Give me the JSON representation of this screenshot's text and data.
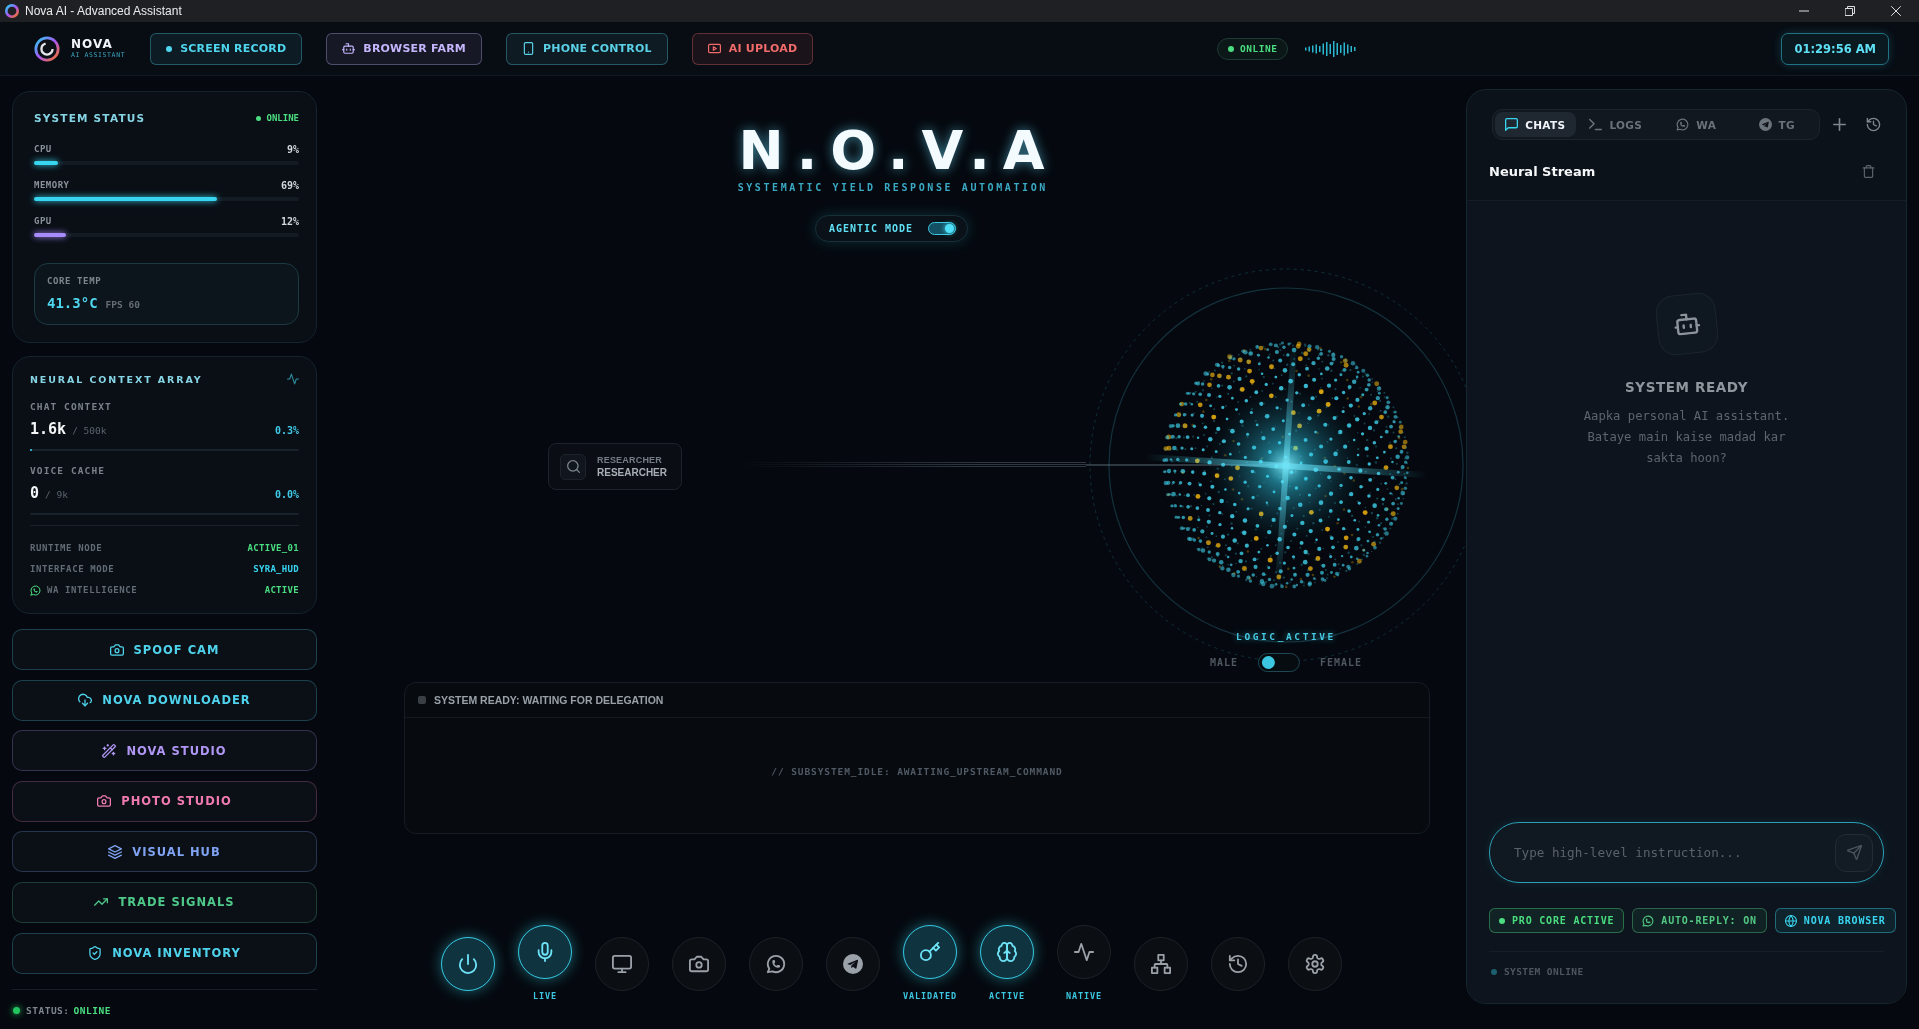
{
  "window": {
    "title": "Nova AI - Advanced Assistant"
  },
  "header": {
    "brand": "NOVA",
    "tagline": "AI ASSISTANT",
    "buttons": [
      {
        "label": "SCREEN RECORD",
        "kind": "record",
        "color": "#4fd6ef"
      },
      {
        "label": "BROWSER FARM",
        "kind": "bot",
        "color": "#c4b5fd"
      },
      {
        "label": "PHONE CONTROL",
        "kind": "phone",
        "color": "#5ad1e6"
      },
      {
        "label": "AI UPLOAD",
        "kind": "video",
        "color": "#f26b6b"
      }
    ],
    "status": "ONLINE",
    "clock": "01:29:56 AM"
  },
  "system_status": {
    "title": "SYSTEM STATUS",
    "status": "ONLINE",
    "meters": [
      {
        "name": "CPU",
        "value": "9%",
        "level": 0.09,
        "color": "#38d5f0"
      },
      {
        "name": "MEMORY",
        "value": "69%",
        "level": 0.69,
        "color": "#38d5f0"
      },
      {
        "name": "GPU",
        "value": "12%",
        "level": 0.12,
        "color": "#a78bfa"
      }
    ],
    "core_temp": {
      "label": "CORE TEMP",
      "value": "41.3°C",
      "fps": "FPS 60"
    }
  },
  "neural_context": {
    "title": "NEURAL CONTEXT ARRAY",
    "contexts": [
      {
        "label": "CHAT CONTEXT",
        "value": "1.6k",
        "limit": "/ 500k",
        "percent": "0.3%",
        "level": 0.003
      },
      {
        "label": "VOICE CACHE",
        "value": "0",
        "limit": "/ 9k",
        "percent": "0.0%"
      }
    ],
    "rows": [
      {
        "label": "RUNTIME NODE",
        "value": "ACTIVE_01",
        "kind": "plain",
        "color": "#4ade80"
      },
      {
        "label": "INTERFACE MODE",
        "value": "SYRA_HUD",
        "kind": "plain",
        "color": "#38d5f0"
      },
      {
        "label": "WA INTELLIGENCE",
        "value": "ACTIVE",
        "kind": "whatsapp",
        "color": "#4ade80"
      }
    ]
  },
  "tools": [
    {
      "label": "SPOOF CAM",
      "kind": "camera",
      "color": "#4fd3ec"
    },
    {
      "label": "NOVA DOWNLOADER",
      "kind": "download",
      "color": "#4fd3ec"
    },
    {
      "label": "NOVA STUDIO",
      "kind": "wand",
      "color": "#b197f5"
    },
    {
      "label": "PHOTO STUDIO",
      "kind": "camera",
      "color": "#f07ab0"
    },
    {
      "label": "VISUAL HUB",
      "kind": "layers",
      "color": "#7fa3f2"
    },
    {
      "label": "TRADE SIGNALS",
      "kind": "trend",
      "color": "#4fc98a"
    },
    {
      "label": "NOVA INVENTORY",
      "kind": "shield",
      "color": "#4fd3ec"
    }
  ],
  "footer_status": {
    "label": "STATUS:",
    "value": "ONLINE"
  },
  "hero": {
    "title": "N.O.V.A",
    "subtitle": "SYSTEMATIC YIELD RESPONSE AUTOMATION",
    "agentic_mode": {
      "label": "AGENTIC MODE",
      "on": true
    }
  },
  "agent": {
    "role": "RESEARCHER",
    "name": "RESEARCHER"
  },
  "orb": {
    "status": "LOGIC_ACTIVE",
    "voice": {
      "left": "MALE",
      "right": "FEMALE",
      "on": false
    }
  },
  "log": {
    "title": "SYSTEM READY: WAITING FOR DELEGATION",
    "idle": "// SUBSYSTEM_IDLE: AWAITING_UPSTREAM_COMMAND"
  },
  "dock": [
    {
      "kind": "power",
      "on": true
    },
    {
      "kind": "mic",
      "on": true,
      "label": "LIVE"
    },
    {
      "kind": "monitor",
      "on": false
    },
    {
      "kind": "camera",
      "on": false
    },
    {
      "kind": "whatsapp",
      "on": false
    },
    {
      "kind": "telegram",
      "on": false
    },
    {
      "kind": "key",
      "on": true,
      "label": "VALIDATED"
    },
    {
      "kind": "brain",
      "on": true,
      "label": "ACTIVE"
    },
    {
      "kind": "pulse",
      "on": false,
      "label": "NATIVE"
    },
    {
      "kind": "network",
      "on": false
    },
    {
      "kind": "history",
      "on": false
    },
    {
      "kind": "settings",
      "on": false
    }
  ],
  "chat_panel": {
    "tabs": [
      {
        "label": "CHATS",
        "kind": "chat",
        "selected": true
      },
      {
        "label": "LOGS",
        "kind": "terminal",
        "selected": false
      },
      {
        "label": "WA",
        "kind": "whatsapp",
        "selected": false
      },
      {
        "label": "TG",
        "kind": "telegram",
        "selected": false
      }
    ],
    "title": "Neural Stream",
    "empty": {
      "title": "SYSTEM READY",
      "text": "Aapka personal AI assistant. Bataye main kaise madad kar sakta hoon?"
    },
    "input": {
      "placeholder": "Type high-level instruction..."
    },
    "chips": [
      {
        "label": "PRO CORE ACTIVE",
        "kind": "dot",
        "color": "#4ade80"
      },
      {
        "label": "AUTO-REPLY: ON",
        "kind": "whatsapp",
        "color": "#52c882"
      },
      {
        "label": "NOVA BROWSER",
        "kind": "globe",
        "color": "#38d5f0"
      }
    ],
    "status": "SYSTEM ONLINE"
  }
}
